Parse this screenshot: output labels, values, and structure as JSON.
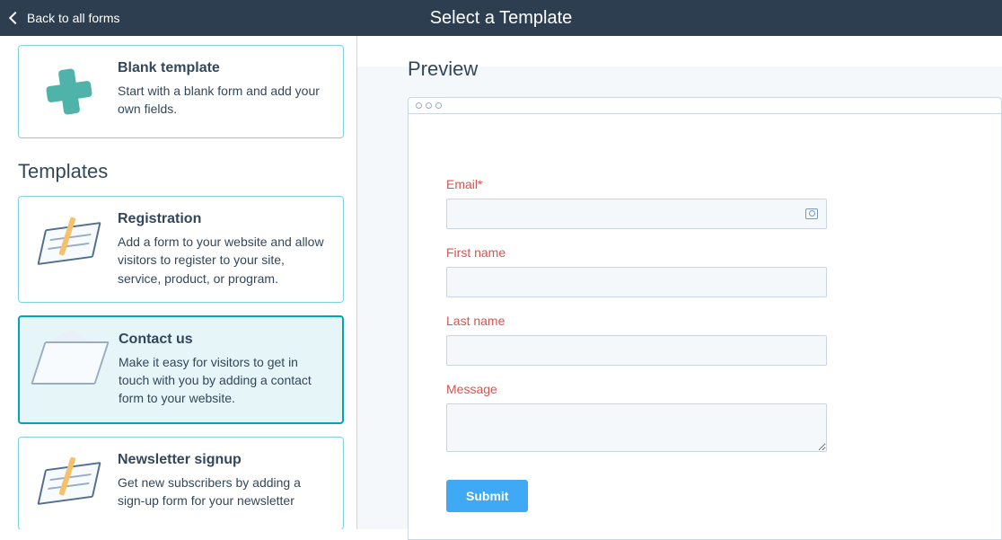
{
  "header": {
    "back_label": "Back to all forms",
    "title": "Select a Template"
  },
  "sidebar": {
    "blank": {
      "title": "Blank template",
      "desc": "Start with a blank form and add your own fields."
    },
    "section_heading": "Templates",
    "templates": [
      {
        "id": "registration",
        "title": "Registration",
        "desc": "Add a form to your website and allow visitors to register to your site, service, product, or program.",
        "selected": false
      },
      {
        "id": "contact-us",
        "title": "Contact us",
        "desc": "Make it easy for visitors to get in touch with you by adding a contact form to your website.",
        "selected": true
      },
      {
        "id": "newsletter",
        "title": "Newsletter signup",
        "desc": "Get new subscribers by adding a sign-up form for your newsletter",
        "selected": false
      }
    ]
  },
  "preview": {
    "heading": "Preview",
    "fields": {
      "email_label": "Email*",
      "first_name_label": "First name",
      "last_name_label": "Last name",
      "message_label": "Message"
    },
    "submit_label": "Submit"
  }
}
